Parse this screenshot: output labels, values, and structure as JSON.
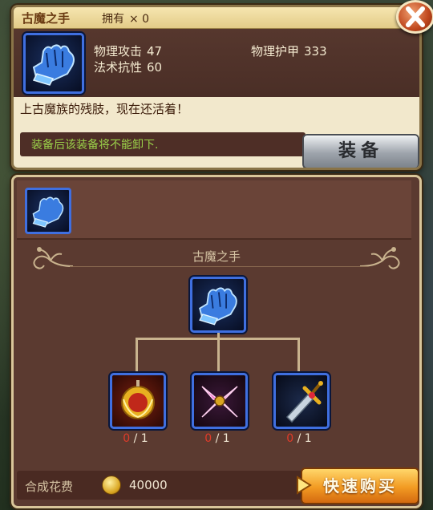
{
  "item": {
    "name": "古魔之手",
    "owned_label": "拥有",
    "owned_count": "× 0",
    "description": "上古魔族的残肢，现在还活着！"
  },
  "stats": [
    {
      "label": "物理攻击",
      "value": "47"
    },
    {
      "label": "物理护甲",
      "value": "333"
    },
    {
      "label": "法术抗性",
      "value": "60"
    }
  ],
  "warning": "装备后该装备将不能卸下.",
  "buttons": {
    "equip": "装备",
    "buy": "快速购买"
  },
  "recipe": {
    "title": "古魔之手",
    "components": [
      {
        "have": "0",
        "need": "/ 1",
        "icon": "golden-laurel-amulet-icon"
      },
      {
        "have": "0",
        "need": "/ 1",
        "icon": "pink-shuriken-icon"
      },
      {
        "have": "0",
        "need": "/ 1",
        "icon": "jeweled-sword-icon"
      }
    ]
  },
  "cost": {
    "label": "合成花费",
    "value": "40000"
  },
  "colors": {
    "accent_blue": "#3f6fe0",
    "warning_green": "#9bd24a",
    "have_red": "#e03a2a",
    "panel_brown": "#5b3a30"
  }
}
